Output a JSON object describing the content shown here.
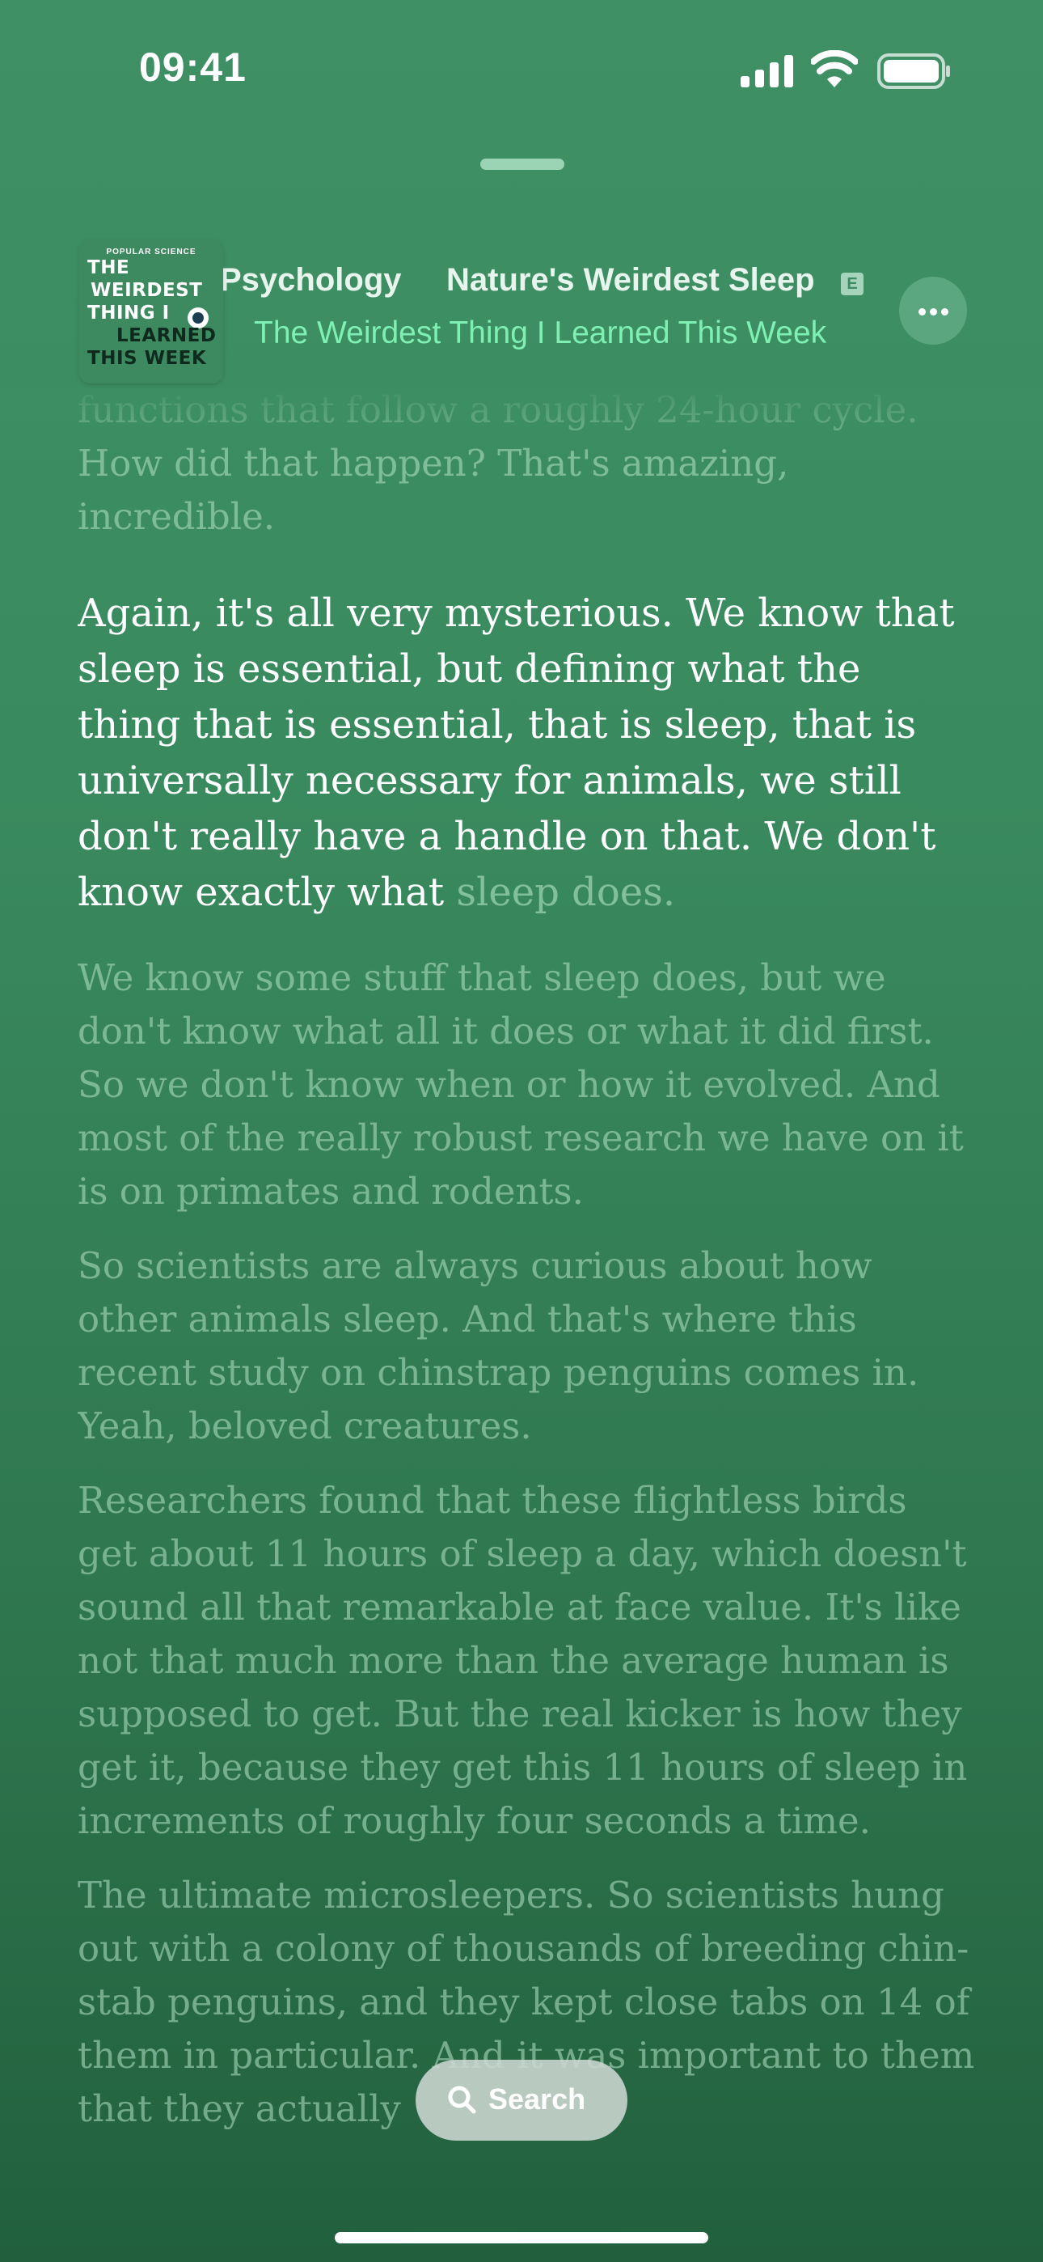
{
  "status_bar": {
    "time": "09:41",
    "icons": [
      "cellular-signal-icon",
      "wifi-icon",
      "battery-icon"
    ]
  },
  "now_playing": {
    "artwork": {
      "publisher": "POPULAR SCIENCE",
      "lines": [
        "THE",
        "WEIRDEST",
        "THING I",
        "LEARNED",
        "THIS WEEK"
      ]
    },
    "title_previous_fragment": "Psychology",
    "title": "Nature's Weirdest Sleep",
    "explicit_badge": "E",
    "show": "The Weirdest Thing I Learned This Week",
    "more_icon": "ellipsis-icon"
  },
  "transcript": {
    "paragraphs": [
      {
        "text": "functions that follow a roughly 24-hour cycle. How did that happen? That's amazing, incredible."
      },
      {
        "spoken": "Again, it's all very mysterious. We know that sleep is essential, but defining what the thing that is essential, that is sleep, that is universally necessary for animals, we still don't really have a handle on that. We don't know exactly what",
        "upcoming": " sleep does."
      },
      {
        "text": "We know some stuff that sleep does, but we don't know what all it does or what it did first. So we don't know when or how it evolved. And most of the really robust research we have on it is on primates and rodents."
      },
      {
        "text": "So scientists are always curious about how other animals sleep. And that's where this recent study on chinstrap penguins comes in. Yeah, beloved creatures."
      },
      {
        "text": "Researchers found that these flightless birds get about 11 hours of sleep a day, which doesn't sound all that remarkable at face value. It's like not that much more than the average human is supposed to get. But the real kicker is how they get it, because they get this 11 hours of sleep in increments of roughly four seconds a time."
      },
      {
        "text": "The ultimate microsleepers. So scientists hung out with a colony of thousands of breeding chin-stab penguins, and they kept close tabs on 14 of them in particular. And it was important to them that they actually"
      }
    ]
  },
  "search": {
    "label": "Search",
    "icon": "search-icon"
  },
  "colors": {
    "background_top": "#3f9065",
    "background_bottom": "#22603d",
    "show_text": "#7ff0b3",
    "active_text": "#ffffff"
  }
}
